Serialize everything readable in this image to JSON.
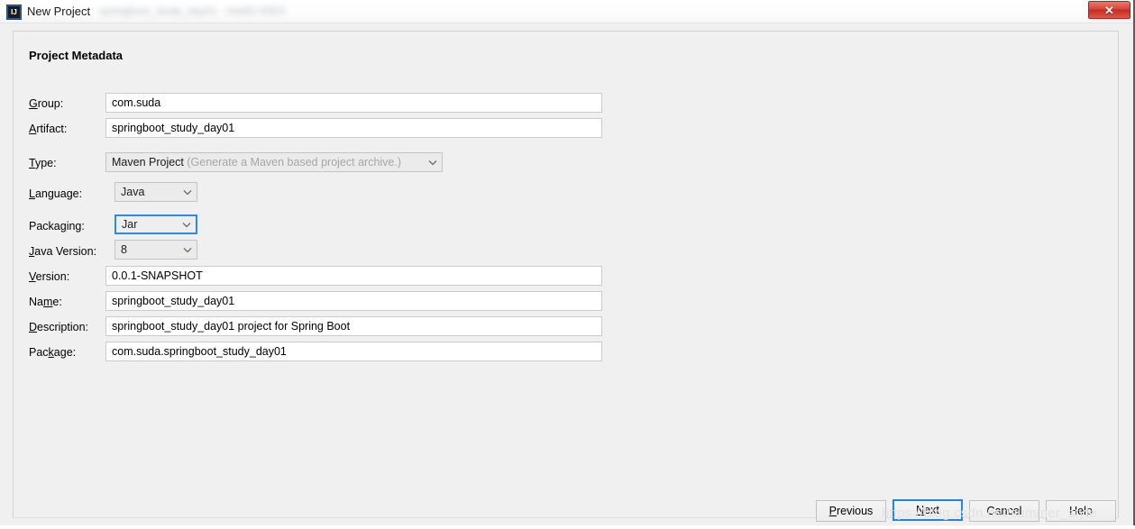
{
  "window": {
    "title": "New Project",
    "blurred_title_suffix": "springboot_study_day01 - IntelliJ IDEA",
    "app_icon": "intellij-idea-icon",
    "icon_letters": "IJ",
    "close_label": "✕"
  },
  "section": {
    "title": "Project Metadata"
  },
  "fields": [
    {
      "key": "group",
      "label_pre": "",
      "label_mnemonic": "G",
      "label_post": "roup:",
      "value": "com.suda",
      "control": "text"
    },
    {
      "key": "artifact",
      "label_pre": "",
      "label_mnemonic": "A",
      "label_post": "rtifact:",
      "value": "springboot_study_day01",
      "control": "text"
    },
    {
      "key": "type",
      "label_pre": "",
      "label_mnemonic": "T",
      "label_post": "ype:",
      "value": "Maven Project",
      "hint": "(Generate a Maven based project archive.)",
      "control": "combo"
    },
    {
      "key": "language",
      "label_pre": "",
      "label_mnemonic": "L",
      "label_post": "anguage:",
      "value": "Java",
      "control": "combo"
    },
    {
      "key": "packaging",
      "label_pre": "Packa",
      "label_mnemonic": "g",
      "label_post": "ing:",
      "value": "Jar",
      "control": "combo",
      "focused": true
    },
    {
      "key": "java_version",
      "label_pre": "",
      "label_mnemonic": "J",
      "label_post": "ava Version:",
      "value": "8",
      "control": "combo"
    },
    {
      "key": "version",
      "label_pre": "",
      "label_mnemonic": "V",
      "label_post": "ersion:",
      "value": "0.0.1-SNAPSHOT",
      "control": "text"
    },
    {
      "key": "name",
      "label_pre": "Na",
      "label_mnemonic": "m",
      "label_post": "e:",
      "value": "springboot_study_day01",
      "control": "text"
    },
    {
      "key": "description",
      "label_pre": "",
      "label_mnemonic": "D",
      "label_post": "escription:",
      "value": "springboot_study_day01 project for Spring Boot",
      "control": "text"
    },
    {
      "key": "package",
      "label_pre": "Pac",
      "label_mnemonic": "k",
      "label_post": "age:",
      "value": "com.suda.springboot_study_day01",
      "control": "text"
    }
  ],
  "buttons": {
    "previous": {
      "pre": "",
      "mnemonic": "P",
      "post": "revious"
    },
    "next": {
      "pre": "",
      "mnemonic": "N",
      "post": "ext"
    },
    "cancel": {
      "pre": "Cancel",
      "mnemonic": "",
      "post": ""
    },
    "help": {
      "pre": "Help",
      "mnemonic": "",
      "post": ""
    }
  },
  "watermark": "https://blog.csdn.net/summer_style",
  "colors": {
    "dialog_background": "#f0f0f0",
    "focus_blue": "#1e87e5",
    "close_red": "#d9453a",
    "hint_gray": "#a6a6a6",
    "watermark_gray": "#e2e2e2"
  }
}
